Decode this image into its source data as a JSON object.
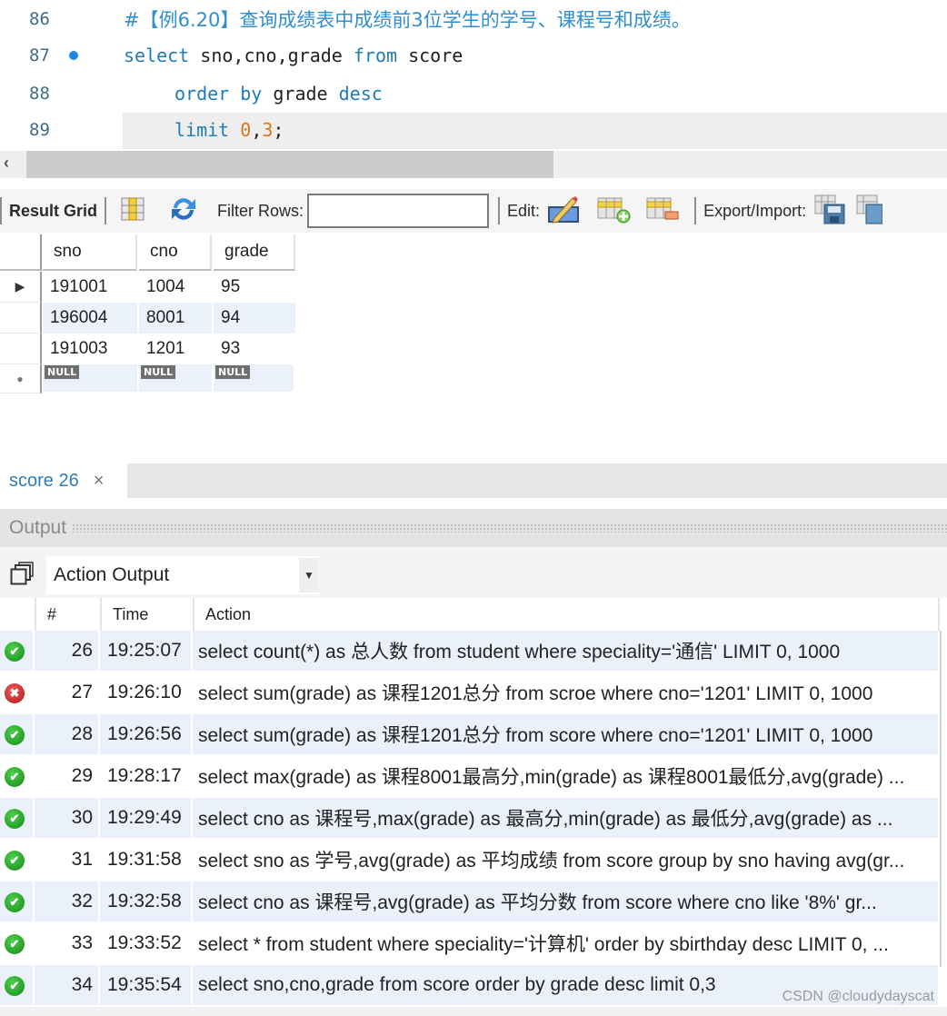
{
  "editor": {
    "lines": [
      {
        "number": "86",
        "comment": "#【例6.20】查询成绩表中成绩前3位学生的学号、课程号和成绩。"
      },
      {
        "number": "87",
        "tokens": [
          "select",
          " sno,cno,grade ",
          "from",
          " score"
        ],
        "breakpoint": true
      },
      {
        "number": "88",
        "tokens": [
          "order by",
          " grade ",
          "desc"
        ]
      },
      {
        "number": "89",
        "tokens": [
          "limit",
          " ",
          "0",
          ",",
          "3",
          ";"
        ]
      }
    ]
  },
  "result_toolbar": {
    "result_grid_label": "Result Grid",
    "filter_label": "Filter Rows:",
    "filter_value": "",
    "edit_label": "Edit:",
    "export_label": "Export/Import:",
    "icons": [
      "form-editor-icon",
      "refresh-icon",
      "edit-row-icon",
      "add-row-icon",
      "delete-row-icon",
      "export-icon",
      "import-icon"
    ]
  },
  "result_grid": {
    "columns": [
      "sno",
      "cno",
      "grade"
    ],
    "rows": [
      [
        "191001",
        "1004",
        "95"
      ],
      [
        "196004",
        "8001",
        "94"
      ],
      [
        "191003",
        "1201",
        "93"
      ]
    ],
    "null_label": "NULL"
  },
  "tabs": [
    {
      "label": "score 26",
      "close": "×"
    }
  ],
  "output": {
    "title": "Output",
    "selector_value": "Action Output",
    "columns": [
      "#",
      "Time",
      "Action"
    ],
    "rows": [
      {
        "status": "ok",
        "num": "26",
        "time": "19:25:07",
        "action": "select count(*) as 总人数 from student  where speciality='通信' LIMIT 0, 1000"
      },
      {
        "status": "error",
        "num": "27",
        "time": "19:26:10",
        "action": "select sum(grade) as 课程1201总分 from scroe where cno='1201' LIMIT 0, 1000"
      },
      {
        "status": "ok",
        "num": "28",
        "time": "19:26:56",
        "action": "select sum(grade) as 课程1201总分 from score where cno='1201' LIMIT 0, 1000"
      },
      {
        "status": "ok",
        "num": "29",
        "time": "19:28:17",
        "action": "select max(grade) as 课程8001最高分,min(grade) as 课程8001最低分,avg(grade) ..."
      },
      {
        "status": "ok",
        "num": "30",
        "time": "19:29:49",
        "action": "select cno as 课程号,max(grade) as 最高分,min(grade) as 最低分,avg(grade) as ..."
      },
      {
        "status": "ok",
        "num": "31",
        "time": "19:31:58",
        "action": "select sno as 学号,avg(grade) as 平均成绩 from score group by sno having avg(gr..."
      },
      {
        "status": "ok",
        "num": "32",
        "time": "19:32:58",
        "action": "select cno as 课程号,avg(grade) as 平均分数 from score where cno like '8%'    gr..."
      },
      {
        "status": "ok",
        "num": "33",
        "time": "19:33:52",
        "action": "select * from student where speciality='计算机'    order by sbirthday desc LIMIT 0, ..."
      },
      {
        "status": "ok",
        "num": "34",
        "time": "19:35:54",
        "action": "select sno,cno,grade from score order by grade desc     limit 0,3"
      }
    ]
  },
  "watermark": "CSDN @cloudydayscat",
  "colors": {
    "keyword": "#1f7bb8",
    "number": "#d4781c",
    "comment": "#2f8fd0",
    "tab_label": "#2e7bbd",
    "ok": "#1e9e1e",
    "error": "#c62828",
    "alt_row": "#eaf1fb"
  }
}
